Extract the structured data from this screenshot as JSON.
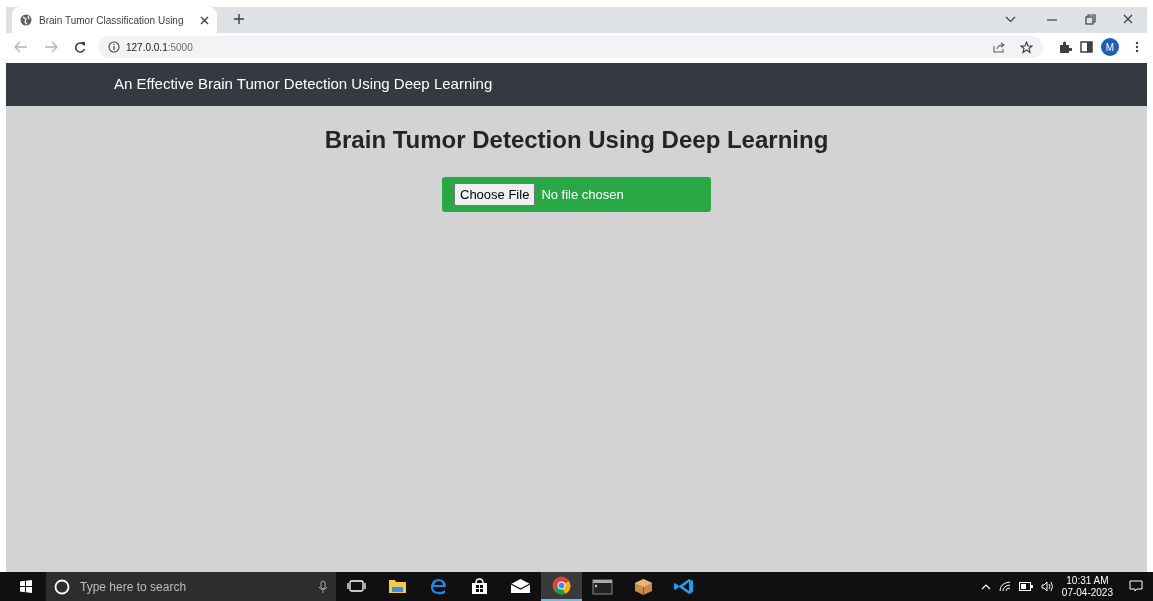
{
  "browser": {
    "tabs": [
      {
        "title": "Brain Tumor Classification Using",
        "selected": true
      }
    ],
    "address": {
      "host": "127.0.0.1",
      "port": ":5000"
    },
    "profile_initial": "M"
  },
  "navbar": {
    "brand": "An Effective Brain Tumor Detection Using Deep Learning"
  },
  "page": {
    "heading": "Brain Tumor Detection Using Deep Learning",
    "file_input": {
      "button": "Choose File",
      "status": "No file chosen"
    }
  },
  "taskbar": {
    "search": {
      "placeholder": "Type here to search"
    },
    "apps": [
      {
        "kind": "taskview",
        "selected": false
      },
      {
        "kind": "folder",
        "selected": false
      },
      {
        "kind": "edge",
        "selected": false
      },
      {
        "kind": "store",
        "selected": false
      },
      {
        "kind": "mail",
        "selected": false
      },
      {
        "kind": "chrome",
        "selected": true
      },
      {
        "kind": "terminal",
        "selected": false
      },
      {
        "kind": "box",
        "selected": false
      },
      {
        "kind": "vscode",
        "selected": false
      }
    ],
    "time": "10:31 AM",
    "date": "07-04-2023"
  }
}
